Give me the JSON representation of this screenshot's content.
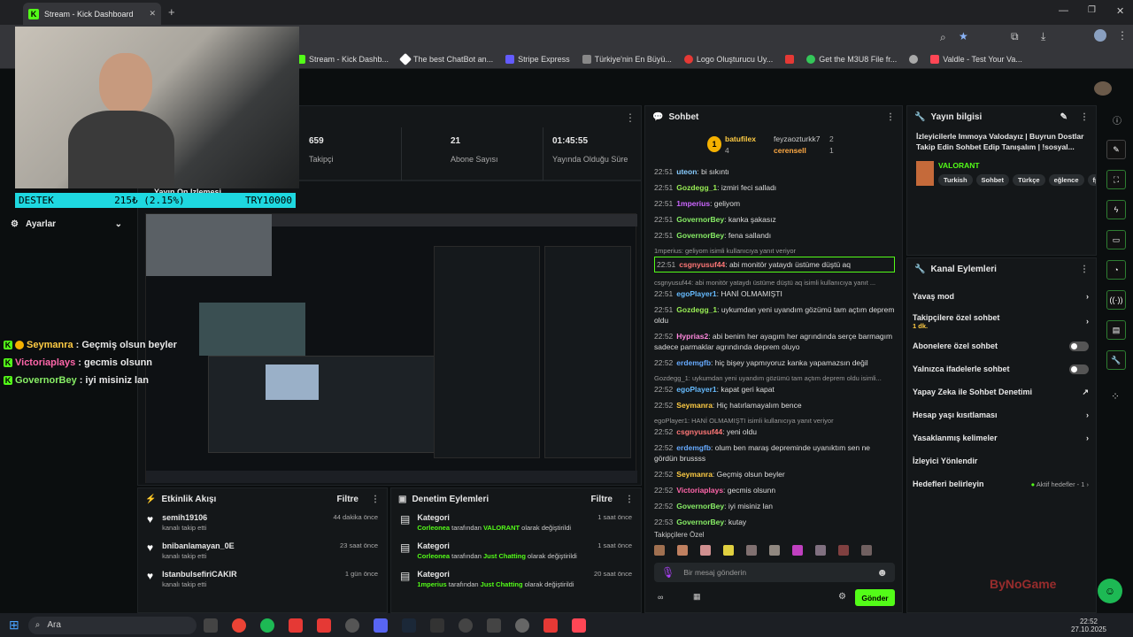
{
  "browser": {
    "tab_title": "Stream - Kick Dashboard",
    "bookmarks": [
      "Stream - Kick Dashb...",
      "The best ChatBot an...",
      "Stripe Express",
      "Türkiye'nin En Büyü...",
      "Logo Oluşturucu Uy...",
      "Get the M3U8 File fr...",
      "Valdle - Test Your Va..."
    ]
  },
  "webcam": {
    "ticker_label": "DESTEK",
    "ticker_value": "215₺ (2.15%)",
    "ticker_goal": "TRY10000"
  },
  "left_menu": {
    "settings": "Ayarlar",
    "preview_label": "Yayın Ön İzlemesi"
  },
  "overlay_chat": [
    {
      "user": "Seymanra",
      "msg": " : Geçmiş olsun beyler",
      "color": "#ffcc44"
    },
    {
      "user": "Victoriaplays",
      "msg": " : gecmis olsunn",
      "color": "#ff66aa"
    },
    {
      "user": "GovernorBey",
      "msg": " : iyi misiniz lan",
      "color": "#88ee66"
    }
  ],
  "stats": [
    {
      "value": "659",
      "label": "Takipçi"
    },
    {
      "value": "21",
      "label": "Abone Sayısı"
    },
    {
      "value": "01:45:55",
      "label": "Yayında Olduğu Süre"
    }
  ],
  "activity": {
    "title": "Etkinlik Akışı",
    "filter": "Filtre",
    "items": [
      {
        "user": "semih19106",
        "action": "kanalı takip etti",
        "time": "44 dakika önce"
      },
      {
        "user": "bnibanlamayan_0E",
        "action": "kanalı takip etti",
        "time": "23 saat önce"
      },
      {
        "user": "IstanbulsefiriCAKIR",
        "action": "kanalı takip etti",
        "time": "1 gün önce"
      }
    ]
  },
  "moderation": {
    "title": "Denetim Eylemleri",
    "filter": "Filtre",
    "items": [
      {
        "title": "Kategori",
        "user": "Corleonea",
        "mid": " tarafından ",
        "cat": "VALORANT",
        "end": " olarak değiştirildi",
        "time": "1 saat önce"
      },
      {
        "title": "Kategori",
        "user": "Corleonea",
        "mid": " tarafından ",
        "cat": "Just Chatting",
        "end": " olarak değiştirildi",
        "time": "1 saat önce"
      },
      {
        "title": "Kategori",
        "user": "1mperius",
        "mid": " tarafından ",
        "cat": "Just Chatting",
        "end": " olarak değiştirildi",
        "time": "20 saat önce"
      }
    ]
  },
  "chat": {
    "title": "Sohbet",
    "top_gifters": [
      {
        "rank": "1",
        "name": "batufilex",
        "count": "4"
      },
      {
        "rank": "",
        "name": "feyzaozturkk7",
        "count": "2"
      },
      {
        "rank": "",
        "name": "cerensell",
        "count": "1"
      }
    ],
    "messages": [
      {
        "time": "22:51",
        "user": "uteon",
        "text": ": bi sıkıntı",
        "color": "#88ccff"
      },
      {
        "time": "22:51",
        "user": "Gozdegg_1",
        "text": ": izmiri feci salladı",
        "color": "#99ee55"
      },
      {
        "time": "22:51",
        "user": "1mperius",
        "text": ": geliyom",
        "color": "#cc66ff"
      },
      {
        "time": "22:51",
        "user": "GovernorBey",
        "text": ": kanka şakasız",
        "color": "#88ee66"
      },
      {
        "time": "22:51",
        "user": "GovernorBey",
        "text": ": fena sallandı",
        "color": "#88ee66"
      },
      {
        "time": "22:51",
        "user": "csgnyusuf44",
        "text": ": abi monitör yataydı üstüme düştü aq",
        "color": "#ff7777",
        "reply": "1mperius: geliyom isimli kullanıcıya yanıt veriyor"
      },
      {
        "time": "22:51",
        "user": "egoPlayer1",
        "text": ": HANİ OLMAMIŞTI",
        "color": "#66bbff",
        "reply": "csgnyusuf44: abi monitör yataydı üstüme düştü aq isimli kullanıcıya yanıt ..."
      },
      {
        "time": "22:51",
        "user": "Gozdegg_1",
        "text": ": uykumdan yeni uyandım gözümü tam açtım deprem oldu",
        "color": "#99ee55"
      },
      {
        "time": "22:52",
        "user": "Hyprias2",
        "text": ": abi benim her ayagım her agrındında serçe barmagım sadece parmaklar agrındında deprem oluyo",
        "color": "#ff88dd"
      },
      {
        "time": "22:52",
        "user": "erdemgfb",
        "text": ": hiç bişey yapmıyoruz kanka yapamazsın değil",
        "color": "#66aaff"
      },
      {
        "time": "22:52",
        "user": "egoPlayer1",
        "text": ": kapat geri kapat",
        "color": "#66bbff",
        "reply": "Gozdegg_1: uykumdan yeni uyandım gözümü tam açtım deprem oldu isimli..."
      },
      {
        "time": "22:52",
        "user": "Seymanra",
        "text": ": Hiç hatırlamayalım bence",
        "color": "#ffcc44"
      },
      {
        "time": "22:52",
        "user": "csgnyusuf44",
        "text": ": yeni oldu",
        "color": "#ff7777",
        "reply": "egoPlayer1: HANİ OLMAMIŞTI isimli kullanıcıya yanıt veriyor"
      },
      {
        "time": "22:52",
        "user": "erdemgfb",
        "text": ": olum ben maraş depreminde uyanıktım sen ne gördün brussss",
        "color": "#66aaff"
      },
      {
        "time": "22:52",
        "user": "Seymanra",
        "text": ": Geçmiş olsun beyler",
        "color": "#ffcc44"
      },
      {
        "time": "22:52",
        "user": "Victoriaplays",
        "text": ": gecmis olsunn",
        "color": "#ff66aa"
      },
      {
        "time": "22:52",
        "user": "GovernorBey",
        "text": ": iyi misiniz lan",
        "color": "#88ee66"
      },
      {
        "time": "22:53",
        "user": "GovernorBey",
        "text": ": kutay",
        "color": "#88ee66"
      }
    ],
    "followers_only": "Takipçilere Özel",
    "placeholder": "Bir mesaj gönderin",
    "send": "Gönder"
  },
  "stream_info": {
    "title": "Yayın bilgisi",
    "stream_title": "İzleyicilerle Immoya Valodayız | Buyrun Dostlar Takip Edin Sohbet Edip Tanışalım | !sosyal...",
    "category": "VALORANT",
    "tags": [
      "Turkish",
      "Sohbet",
      "Türkçe",
      "eğlence",
      "fp"
    ]
  },
  "channel_actions": {
    "title": "Kanal Eylemleri",
    "slow_mode": "Yavaş mod",
    "followers_only": "Takipçilere özel sohbet",
    "followers_only_sub": "1 dk.",
    "subscribers_only": "Abonelere özel sohbet",
    "emotes_only": "Yalnızca ifadelerle sohbet",
    "ai_moderation": "Yapay Zeka ile Sohbet Denetimi",
    "age_restriction": "Hesap yaşı kısıtlaması",
    "banned_words": "Yasaklanmış kelimeler",
    "raid": "İzleyici Yönlendir",
    "goals": "Hedefleri belirleyin",
    "goals_status": "Aktif hedefler - 1"
  },
  "watermark": "ByNoGame",
  "taskbar": {
    "search": "Ara",
    "time": "22:52",
    "date": "27.10.2025"
  }
}
